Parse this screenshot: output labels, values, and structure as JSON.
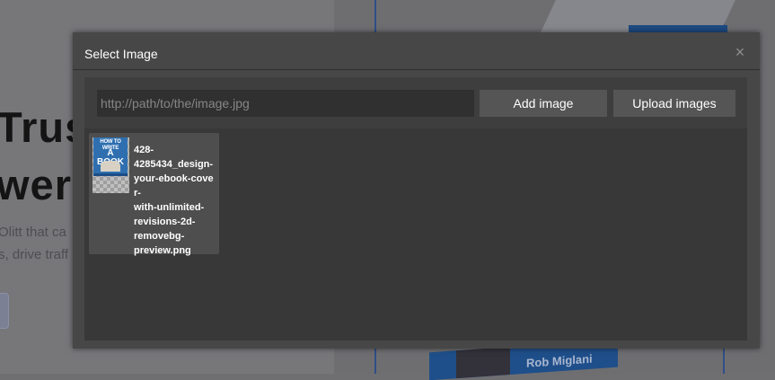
{
  "background": {
    "heading_line1": "Trust",
    "heading_line2": "wer",
    "paragraph_line1": "Olitt that ca",
    "paragraph_line2": "s, drive traff",
    "book_author": "Rob Miglani"
  },
  "modal": {
    "title": "Select Image",
    "close_label": "×",
    "url_input": {
      "value": "",
      "placeholder": "http://path/to/the/image.jpg"
    },
    "add_button_label": "Add image",
    "upload_button_label": "Upload images",
    "assets": [
      {
        "file_name": "428-\n4285434_design-\nyour-ebook-cover-\nwith-unlimited-\nrevisions-2d-\nremovebg-\npreview.png",
        "thumbnail": {
          "title_small": "HOW TO WRITE",
          "title_big": "A BOOK",
          "icon": "ebook-thumbnail-icon"
        }
      }
    ]
  },
  "colors": {
    "overlay": "#6f6f72",
    "modal_bg": "#474747",
    "body_bg": "#383838",
    "button_bg": "#555555",
    "text": "#ffffff",
    "accent_blue": "#2f4f86"
  }
}
